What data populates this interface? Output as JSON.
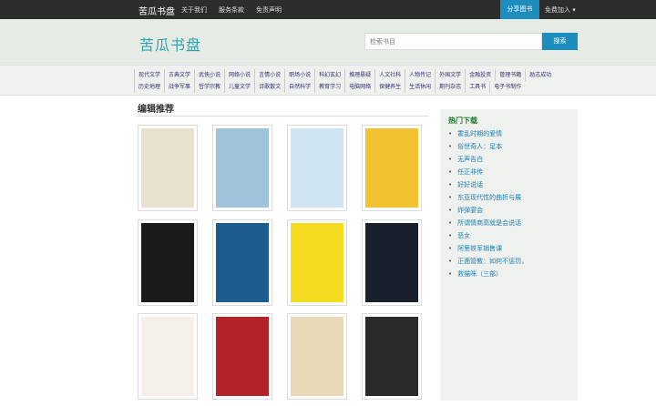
{
  "topbar": {
    "brand": "苦瓜书盘",
    "nav": [
      "关于我们",
      "服务条款",
      "免责声明"
    ],
    "share": "分享图书",
    "join": "免费加入 ▾"
  },
  "header": {
    "logo": "苦瓜书盘",
    "search_placeholder": "检索书目",
    "search_button": "搜索"
  },
  "categories": [
    "现代文学",
    "古典文学",
    "武侠小说",
    "网络小说",
    "言情小说",
    "职场小说",
    "科幻玄幻",
    "推理悬疑",
    "人文社科",
    "人物传记",
    "外国文学",
    "金融投资",
    "管理书籍",
    "励志成功",
    "历史地理",
    "战争军事",
    "哲学宗教",
    "儿童文学",
    "诗歌散文",
    "自然科学",
    "教育学习",
    "电脑网络",
    "保健养生",
    "生活休闲",
    "期刊杂志",
    "工具书",
    "电子书制作"
  ],
  "main": {
    "title": "编辑推荐"
  },
  "books": [
    {
      "color": "#e9e2d0"
    },
    {
      "color": "#9fc3db"
    },
    {
      "color": "#cfe6f2"
    },
    {
      "color": "#f2c230"
    },
    {
      "color": "#1b1b1b"
    },
    {
      "color": "#1d5c8f"
    },
    {
      "color": "#f5dc20"
    },
    {
      "color": "#1a1f2e"
    },
    {
      "color": "#f4efe8"
    },
    {
      "color": "#b52226"
    },
    {
      "color": "#e8d9b8"
    },
    {
      "color": "#2a2a2a"
    }
  ],
  "sidebar": {
    "title": "热门下载",
    "items": [
      "霍乱时期的爱情",
      "俗世奇人：足本",
      "无声告白",
      "任正非传",
      "好好说话",
      "东亚现代性的曲折与展",
      "炸弹宴会",
      "所谓情商高就是会说话",
      "恶女",
      "阿里铁军销售课",
      "正面管教：如何不惩罚，",
      "救猫咪（三部）"
    ]
  }
}
